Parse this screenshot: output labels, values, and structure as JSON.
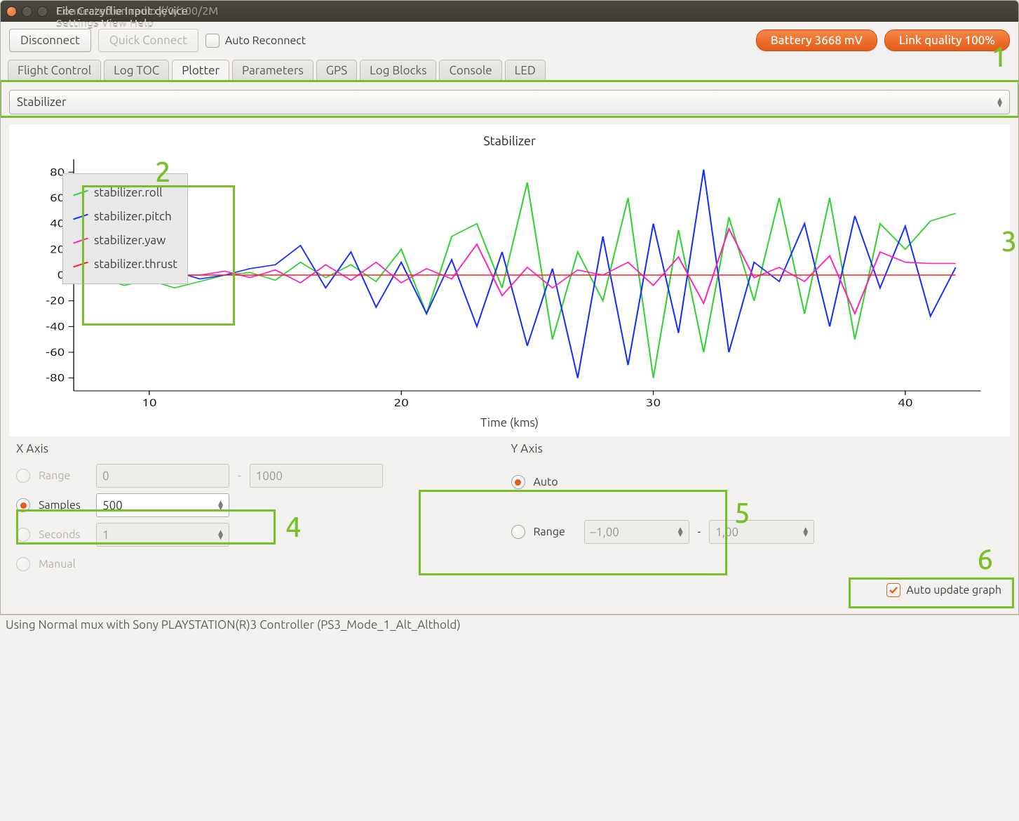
{
  "window": {
    "title_layer1": "Connected on radio://0/100/2M",
    "title_layer2": "File   Crazyflie   Input device   Settings   View   Help"
  },
  "toolbar": {
    "disconnect_label": "Disconnect",
    "quick_connect_label": "Quick Connect",
    "auto_reconnect_label": "Auto Reconnect",
    "battery_label": "Battery 3668 mV",
    "link_quality_label": "Link quality 100%"
  },
  "tabs": [
    "Flight Control",
    "Log TOC",
    "Plotter",
    "Parameters",
    "GPS",
    "Log Blocks",
    "Console",
    "LED"
  ],
  "tabs_active_index": 2,
  "selector": {
    "value": "Stabilizer"
  },
  "plot": {
    "title": "Stabilizer",
    "xlabel": "Time (kms)",
    "legend": [
      {
        "label": "stabilizer.roll",
        "color": "#2fd12f"
      },
      {
        "label": "stabilizer.pitch",
        "color": "#142cff"
      },
      {
        "label": "stabilizer.yaw",
        "color": "#ff1fc0"
      },
      {
        "label": "stabilizer.thrust",
        "color": "#ff1f1f"
      }
    ]
  },
  "xaxis": {
    "title": "X Axis",
    "range_label": "Range",
    "range_from": "0",
    "range_to": "1000",
    "samples_label": "Samples",
    "samples_value": "500",
    "seconds_label": "Seconds",
    "seconds_value": "1",
    "manual_label": "Manual"
  },
  "yaxis": {
    "title": "Y Axis",
    "auto_label": "Auto",
    "range_label": "Range",
    "range_from": "–1,00",
    "range_to": "1,00"
  },
  "auto_update_label": "Auto update graph",
  "status_bar": "Using Normal mux with Sony PLAYSTATION(R)3 Controller (PS3_Mode_1_Alt_Althold)",
  "callouts": [
    "1",
    "2",
    "3",
    "4",
    "5",
    "6"
  ],
  "chart_data": {
    "type": "line",
    "title": "Stabilizer",
    "xlabel": "Time (kms)",
    "ylabel": "",
    "xlim": [
      7,
      43
    ],
    "ylim": [
      -90,
      90
    ],
    "xticks": [
      10,
      20,
      30,
      40
    ],
    "yticks": [
      -80,
      -60,
      -40,
      -20,
      0,
      20,
      40,
      60,
      80
    ],
    "x": [
      7,
      8,
      9,
      10,
      11,
      12,
      13,
      14,
      15,
      16,
      17,
      18,
      19,
      20,
      21,
      22,
      23,
      24,
      25,
      26,
      27,
      28,
      29,
      30,
      31,
      32,
      33,
      34,
      35,
      36,
      37,
      38,
      39,
      40,
      41,
      42
    ],
    "series": [
      {
        "name": "stabilizer.roll",
        "color": "#2fd12f",
        "values": [
          0,
          -2,
          -8,
          -4,
          -10,
          -5,
          0,
          2,
          -4,
          10,
          -2,
          8,
          -5,
          20,
          -30,
          30,
          40,
          -10,
          72,
          -50,
          18,
          -20,
          60,
          -80,
          35,
          -60,
          45,
          -20,
          60,
          -30,
          60,
          -50,
          40,
          20,
          42,
          48
        ]
      },
      {
        "name": "stabilizer.pitch",
        "color": "#142cff",
        "values": [
          0,
          0,
          2,
          0,
          3,
          -3,
          0,
          5,
          8,
          23,
          -10,
          18,
          -25,
          10,
          -30,
          12,
          -40,
          18,
          -55,
          5,
          -80,
          30,
          -70,
          40,
          -45,
          82,
          -60,
          10,
          -5,
          40,
          -40,
          46,
          -10,
          38,
          -32,
          6
        ]
      },
      {
        "name": "stabilizer.yaw",
        "color": "#ff1fc0",
        "values": [
          0,
          0,
          0,
          -2,
          0,
          0,
          3,
          -2,
          4,
          -6,
          8,
          -4,
          10,
          -6,
          5,
          -3,
          24,
          -16,
          6,
          -10,
          4,
          0,
          10,
          -8,
          14,
          -22,
          36,
          -2,
          6,
          -5,
          15,
          -30,
          18,
          10,
          9,
          9
        ]
      },
      {
        "name": "stabilizer.thrust",
        "color": "#ff1f1f",
        "values": [
          0,
          0,
          0,
          0,
          0,
          0,
          0,
          0,
          0,
          0,
          0,
          0,
          0,
          0,
          0,
          0,
          0,
          0,
          0,
          0,
          0,
          0,
          0,
          0,
          0,
          0,
          0,
          0,
          0,
          0,
          0,
          0,
          0,
          0,
          0,
          0
        ]
      }
    ]
  }
}
